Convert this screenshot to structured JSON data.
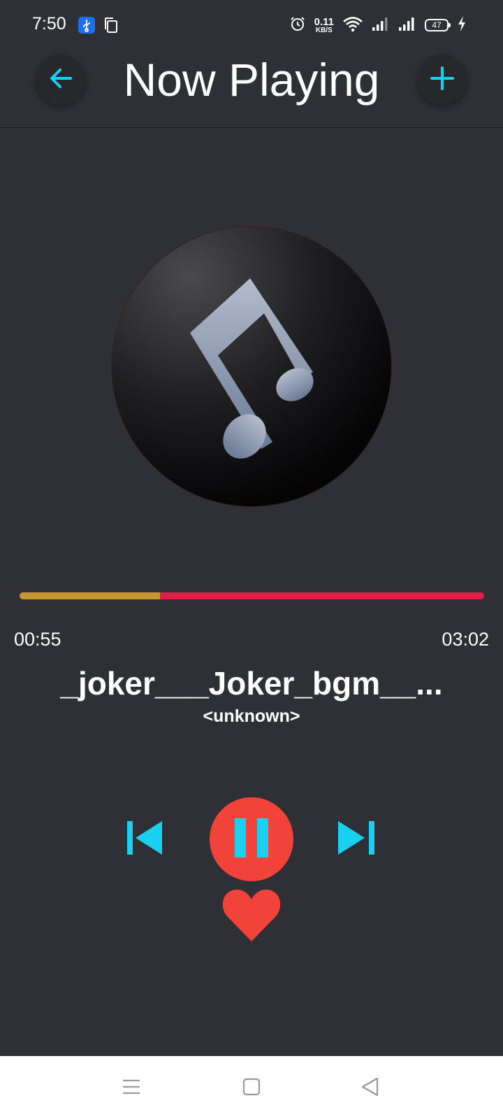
{
  "status_bar": {
    "time": "7:50",
    "net_speed_value": "0.11",
    "net_speed_unit": "KB/S",
    "battery_level": "47",
    "icons": [
      "usb-icon",
      "copy-icon",
      "alarm-icon",
      "wifi-icon",
      "signal-icon",
      "signal-icon",
      "battery-icon",
      "charging-icon"
    ]
  },
  "header": {
    "title": "Now Playing",
    "back_icon": "arrow-left-icon",
    "add_icon": "plus-icon"
  },
  "album_art": {
    "icon": "music-note-icon"
  },
  "player": {
    "elapsed": "00:55",
    "duration": "03:02",
    "progress_fraction": 0.302,
    "track_title": "_joker___Joker_bgm__...",
    "artist": "<unknown>",
    "state": "playing"
  },
  "controls": {
    "previous_icon": "skip-previous-icon",
    "pause_icon": "pause-icon",
    "next_icon": "skip-next-icon",
    "favorite_icon": "heart-icon"
  },
  "nav_bar": {
    "icons": [
      "menu-icon",
      "home-icon",
      "back-icon"
    ]
  },
  "colors": {
    "background": "#2f3035",
    "accent": "#1ad0f0",
    "play_button": "#f2433b",
    "progress_played": "#c99530",
    "progress_remaining": "#e11d48"
  }
}
